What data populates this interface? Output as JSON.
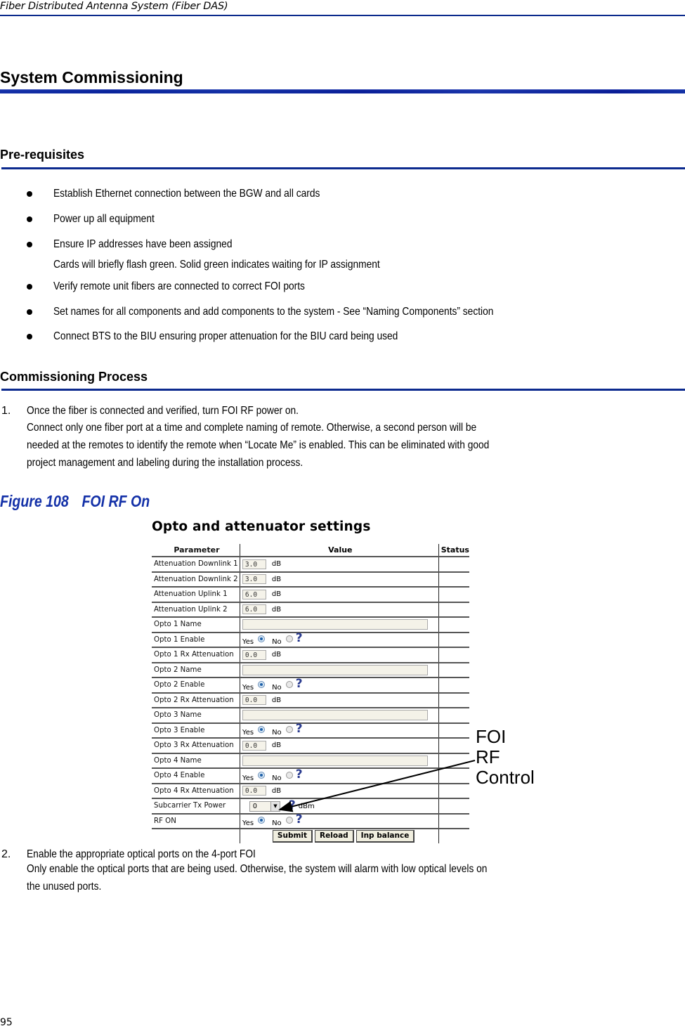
{
  "running_header": "Fiber Distributed Antenna System (Fiber DAS)",
  "chapter_title": "System Commissioning",
  "prerequisites": {
    "title": "Pre-requisites",
    "items": [
      {
        "text": "Establish Ethernet connection between the BGW and all cards"
      },
      {
        "text": "Power up all equipment"
      },
      {
        "text": "Ensure IP addresses have been assigned",
        "note": "Cards will briefly flash green.  Solid green indicates waiting for IP assignment"
      },
      {
        "text": "Verify remote unit fibers are connected to correct FOI ports"
      },
      {
        "text": "Set names for all components and add components to the system - See “Naming Components” section"
      },
      {
        "text": "Connect BTS to the BIU ensuring proper attenuation for the BIU card being used"
      }
    ]
  },
  "process": {
    "title": "Commissioning Process",
    "steps": [
      {
        "number": "1.",
        "lines": [
          "Once the fiber is connected and verified, turn FOI RF power on.",
          "Connect only one fiber port at a time and complete naming of remote. Otherwise, a second person will be",
          "needed at the remotes to identify the remote when “Locate Me” is enabled. This can be eliminated with good",
          "project management and labeling during the installation process."
        ]
      },
      {
        "number": "2.",
        "lines": [
          "Enable the appropriate optical ports on the 4-port FOI",
          "Only enable the optical ports that are being used. Otherwise, the system will alarm with low optical levels on",
          "the unused ports."
        ]
      }
    ]
  },
  "figure": {
    "number": "Figure 108",
    "title": "FOI RF On",
    "screenshot": {
      "title": "Opto and attenuator settings",
      "columns": [
        "Parameter",
        "Value",
        "Status"
      ],
      "rows": [
        {
          "param": "Attenuation Downlink 1",
          "kind": "number",
          "value": "3.0",
          "unit": "dB"
        },
        {
          "param": "Attenuation Downlink 2",
          "kind": "number",
          "value": "3.0",
          "unit": "dB"
        },
        {
          "param": "Attenuation Uplink 1",
          "kind": "number",
          "value": "6.0",
          "unit": "dB"
        },
        {
          "param": "Attenuation Uplink 2",
          "kind": "number",
          "value": "6.0",
          "unit": "dB"
        },
        {
          "param": "Opto 1 Name",
          "kind": "text",
          "value": ""
        },
        {
          "param": "Opto 1 Enable",
          "kind": "radio",
          "selected": "Yes"
        },
        {
          "param": "Opto 1 Rx Attenuation",
          "kind": "number",
          "value": "0.0",
          "unit": "dB"
        },
        {
          "param": "Opto 2 Name",
          "kind": "text",
          "value": ""
        },
        {
          "param": "Opto 2 Enable",
          "kind": "radio",
          "selected": "Yes"
        },
        {
          "param": "Opto 2 Rx Attenuation",
          "kind": "number",
          "value": "0.0",
          "unit": "dB"
        },
        {
          "param": "Opto 3 Name",
          "kind": "text",
          "value": ""
        },
        {
          "param": "Opto 3 Enable",
          "kind": "radio",
          "selected": "Yes"
        },
        {
          "param": "Opto 3 Rx Attenuation",
          "kind": "number",
          "value": "0.0",
          "unit": "dB"
        },
        {
          "param": "Opto 4 Name",
          "kind": "text",
          "value": ""
        },
        {
          "param": "Opto 4 Enable",
          "kind": "radio",
          "selected": "Yes"
        },
        {
          "param": "Opto 4 Rx Attenuation",
          "kind": "number",
          "value": "0.0",
          "unit": "dB"
        },
        {
          "param": "Subcarrier Tx Power",
          "kind": "select",
          "value": "0",
          "unit": "dBm"
        },
        {
          "param": "RF ON",
          "kind": "radio",
          "selected": "Yes"
        }
      ],
      "radio_labels": {
        "yes": "Yes",
        "no": "No"
      },
      "help_glyph": "?",
      "buttons": {
        "submit": "Submit",
        "reload": "Reload",
        "inp_balance": "Inp balance"
      }
    },
    "callout": [
      "FOI",
      "RF",
      "Control"
    ]
  },
  "page_number": "95",
  "colors": {
    "rule_blue": "#0c2a8e",
    "caption_blue": "#1431a8",
    "help_blue": "#2a3b8f",
    "radio_on": "#1c5fa8"
  }
}
